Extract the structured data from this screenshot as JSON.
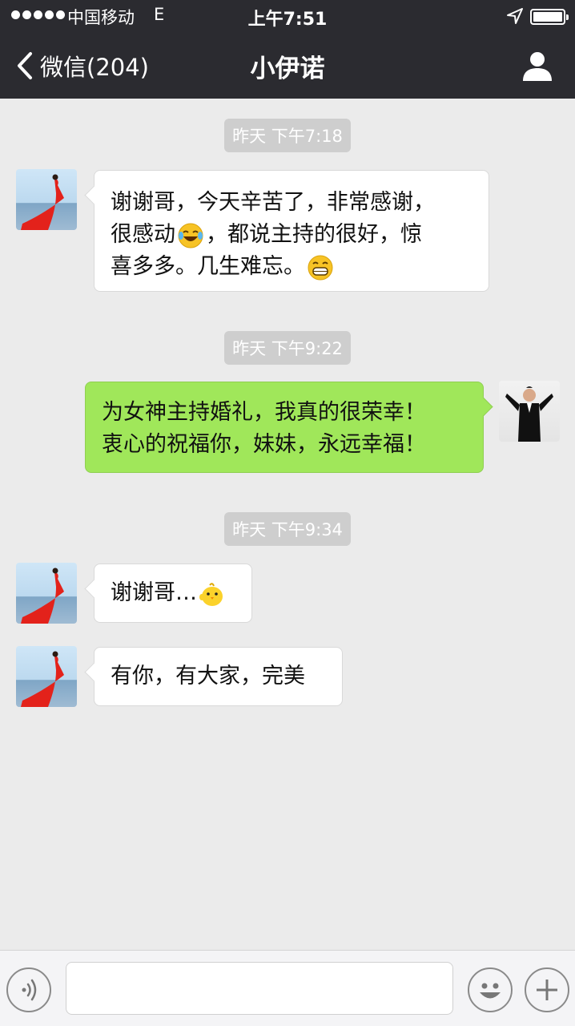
{
  "status_bar": {
    "carrier": "中国移动",
    "network": "E",
    "time": "上午7:51"
  },
  "nav": {
    "back_label": "微信(204)",
    "title": "小伊诺"
  },
  "messages": [
    {
      "kind": "time",
      "text": "昨天 下午7:18"
    },
    {
      "kind": "msg",
      "side": "left",
      "lines": [
        "谢谢哥，今天辛苦了，非常感谢，",
        "很感动",
        "，都说主持的很好，惊",
        "喜多多。几生难忘。"
      ]
    },
    {
      "kind": "time",
      "text": "昨天 下午9:22"
    },
    {
      "kind": "msg",
      "side": "right",
      "lines": [
        "为女神主持婚礼，我真的很荣幸！",
        "衷心的祝福你，妹妹，永远幸福！"
      ]
    },
    {
      "kind": "time",
      "text": "昨天 下午9:34"
    },
    {
      "kind": "msg",
      "side": "left",
      "lines": [
        "谢谢哥…"
      ]
    },
    {
      "kind": "msg",
      "side": "left",
      "lines": [
        "有你，有大家，完美"
      ]
    }
  ],
  "emojis": [
    "tears-of-joy-emoji-icon",
    "grin-emoji-icon",
    "chick-emoji-icon"
  ],
  "input": {
    "value": ""
  }
}
